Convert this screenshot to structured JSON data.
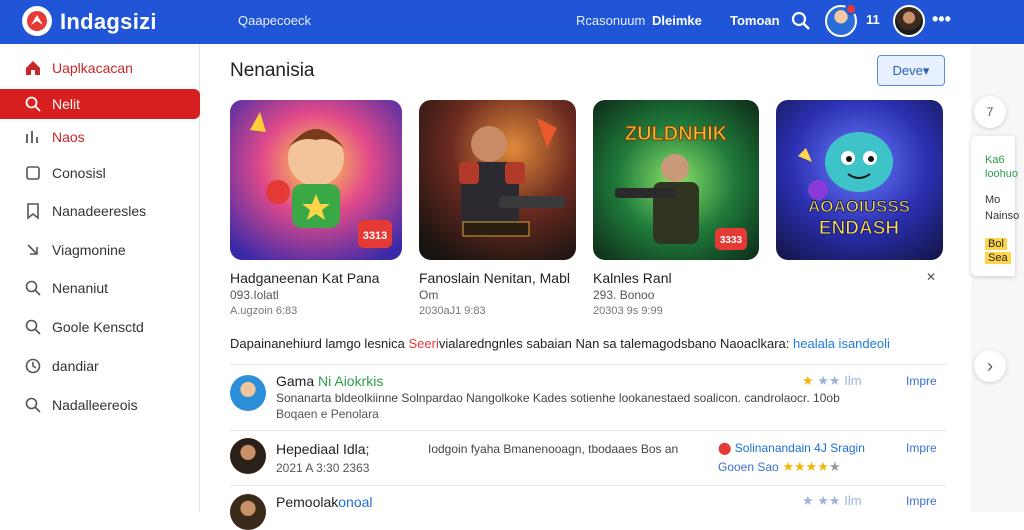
{
  "app": {
    "brand": "Indagsizi",
    "top_nav": [
      "Qaapecoeck",
      "Rcasonuum",
      "Dleimke",
      "Tomoan"
    ],
    "top_n": "11"
  },
  "sidebar": {
    "items": [
      {
        "label": "Uaplkacacan",
        "icon": "home-icon"
      },
      {
        "label": "Nelit",
        "icon": "search-icon"
      },
      {
        "label": "Naos",
        "icon": "chart-icon"
      },
      {
        "label": "Conosisl",
        "icon": "square-icon"
      },
      {
        "label": "Nanadeeresles",
        "icon": "bookmark-icon"
      },
      {
        "label": "Viagmonine",
        "icon": "arrow-icon"
      },
      {
        "label": "Nenaniut",
        "icon": "search-icon"
      },
      {
        "label": "Goole Kensctd",
        "icon": "search-icon"
      },
      {
        "label": "dandiar",
        "icon": "clock-icon"
      },
      {
        "label": "Nadalleereois",
        "icon": "search-icon"
      }
    ]
  },
  "main": {
    "title": "Nenanisia",
    "dropdown": "Deve",
    "cards": [
      {
        "title": "Hadganeenan Kat Pana",
        "sub": "093.Iolatl",
        "meta": "A.ugzoin 6:83",
        "badge": "3313"
      },
      {
        "title": "Fanoslain Nenitan, Mabl",
        "sub": "Om",
        "meta": "2030aJ1 9:83",
        "badge": ""
      },
      {
        "title": "Kalnles Ranl",
        "sub": "293. Bonoo",
        "meta": "20303 9s 9:99",
        "badge": "3333",
        "art_text": "ZULDNHIK"
      },
      {
        "title": "",
        "sub": "",
        "meta": "",
        "art_text1": "AOAOIUSSS",
        "art_text2": "ENDASH"
      }
    ],
    "section": {
      "lead": "Dapainanehiurd lamgo lesnica",
      "highlight": "Seeri",
      "mid": "vialaredngnles sabaian Nan sa talemagodsbano Naoaclkara:",
      "link": "healala isandeoli"
    },
    "rows": [
      {
        "name": "Gama",
        "tag": "Ni Aiokrkis",
        "desc": "Sonanarta bldeolkiinne Solnpardao Nangolkoke Kades sotienhe lookanestaed soalicon. candrolaocr. 10ob",
        "desc2": "Boqaen  e  Penolara",
        "rating": "Ilm",
        "link": "Impre"
      },
      {
        "name": "Hepediaal",
        "tag": "Idla;",
        "desc": "Iodgoin fyaha Bmanenooagn, tbodaaes Bos an",
        "desc2": "2021 A 3:30  2363",
        "right1": "Solinanandain  4J  Sragin",
        "right2": "Gooen Sao",
        "link": "Impre"
      },
      {
        "name": "Pemoolak",
        "tag": "onoal",
        "rating": "Ilm",
        "link": "Impre"
      }
    ]
  },
  "rail": {
    "btn1": "7",
    "card_lines": [
      "Ka6",
      "loohuo",
      "Mo",
      "Nainso",
      "Bol",
      "Sea"
    ],
    "btn2": "›"
  },
  "colors": {
    "topbar": "#1f55d6",
    "accent": "#d71f1f",
    "link": "#1f6fd0"
  }
}
